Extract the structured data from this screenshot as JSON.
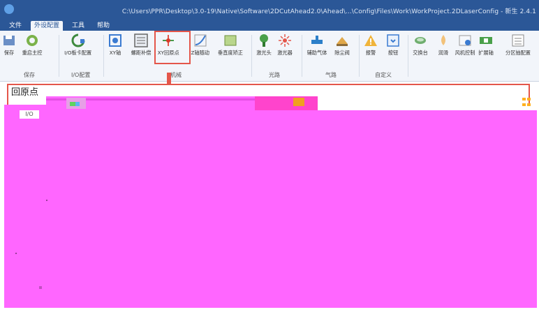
{
  "window": {
    "title": "C:\\Users\\PPR\\Desktop\\3.0-19\\Native\\Software\\2DCutAhead2.0\\Ahead\\...\\Config\\Files\\Work\\WorkProject.2DLaserConfig - 新生 2.4.1"
  },
  "tabs": [
    {
      "label": "文件"
    },
    {
      "label": "外设配置",
      "active": true
    },
    {
      "label": "工具"
    },
    {
      "label": "帮助"
    }
  ],
  "ribbon": {
    "buttons": [
      {
        "label": "保存",
        "icon": "save-icon"
      },
      {
        "label": "重启主控",
        "icon": "restart-icon"
      },
      {
        "label": "I/O板卡配置",
        "icon": "io-board-icon"
      },
      {
        "label": "XY轴",
        "icon": "xy-axis-icon"
      },
      {
        "label": "螺距补偿",
        "icon": "pitch-comp-icon"
      },
      {
        "label": "XY回原点",
        "icon": "xy-home-icon"
      },
      {
        "label": "Z轴随动",
        "icon": "z-follow-icon"
      },
      {
        "label": "垂直度矫正",
        "icon": "perpendicular-icon"
      },
      {
        "label": "激光头",
        "icon": "laser-head-icon"
      },
      {
        "label": "激光器",
        "icon": "laser-icon"
      },
      {
        "label": "辅助气体",
        "icon": "aux-gas-icon"
      },
      {
        "label": "除尘阀",
        "icon": "dust-valve-icon"
      },
      {
        "label": "报警",
        "icon": "alarm-icon"
      },
      {
        "label": "按钮",
        "icon": "button-icon"
      },
      {
        "label": "交换台",
        "icon": "exchange-table-icon"
      },
      {
        "label": "润滑",
        "icon": "lubrication-icon"
      },
      {
        "label": "风机控制",
        "icon": "fan-control-icon"
      },
      {
        "label": "扩展轴",
        "icon": "extend-axis-icon"
      },
      {
        "label": "分区抽配置",
        "icon": "zone-config-icon"
      }
    ],
    "groups": [
      {
        "label": "保存"
      },
      {
        "label": "I/O配置"
      },
      {
        "label": "机械"
      },
      {
        "label": "光路"
      },
      {
        "label": "气路"
      },
      {
        "label": "自定义"
      }
    ]
  },
  "panel": {
    "title": "回原点",
    "left_label": "I/O"
  },
  "colors": {
    "titlebar": "#2b5797",
    "ribbon_bg": "#f2f5fa",
    "highlight": "#e4564a",
    "glitch": "#ff66ff"
  }
}
